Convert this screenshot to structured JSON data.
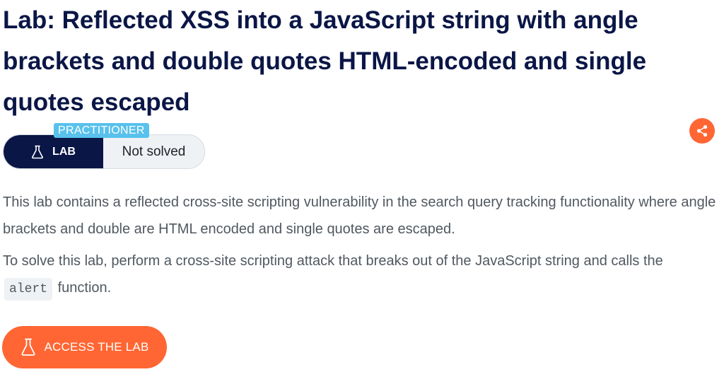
{
  "title": "Lab: Reflected XSS into a JavaScript string with angle brackets and double quotes HTML-encoded and single quotes escaped",
  "badge": {
    "level": "PRACTITIONER",
    "type_label": "LAB",
    "status": "Not solved"
  },
  "description": {
    "paragraph1": "This lab contains a reflected cross-site scripting vulnerability in the search query tracking functionality where angle brackets and double are HTML encoded and single quotes are escaped.",
    "paragraph2_before": "To solve this lab, perform a cross-site scripting attack that breaks out of the JavaScript string and calls the",
    "paragraph2_code": "alert",
    "paragraph2_after": "function."
  },
  "actions": {
    "access_label": "ACCESS THE LAB"
  },
  "icons": {
    "flask": "flask-icon",
    "share": "share-icon"
  },
  "colors": {
    "navy": "#0a1646",
    "orange": "#ff6633",
    "practitioner_blue": "#58c1ec",
    "body_text": "#505860"
  }
}
